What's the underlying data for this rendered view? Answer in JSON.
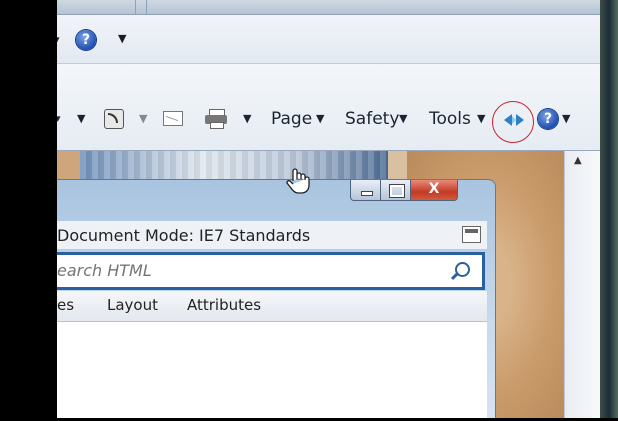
{
  "command_bar": {
    "items": [
      {
        "label": "Page"
      },
      {
        "label": "Safety"
      },
      {
        "label": "Tools"
      }
    ]
  },
  "favorites_bar": {
    "help_label": "?"
  },
  "help_label": "?",
  "dev_tools_window": {
    "document_mode": "Document Mode: IE7 Standards",
    "search_placeholder": "earch HTML",
    "tabs": [
      {
        "label": "es"
      },
      {
        "label": "Layout"
      },
      {
        "label": "Attributes"
      }
    ],
    "close_label": "X"
  },
  "colors": {
    "highlight_circle": "#c8262d",
    "search_border": "#2a5fa0",
    "close_button": "#c23a24"
  },
  "icons": [
    "help-icon",
    "feeds-icon",
    "mail-icon",
    "print-icon",
    "developer-tools-icon",
    "search-icon",
    "minimize-icon",
    "maximize-icon",
    "close-icon",
    "hand-cursor-icon"
  ]
}
